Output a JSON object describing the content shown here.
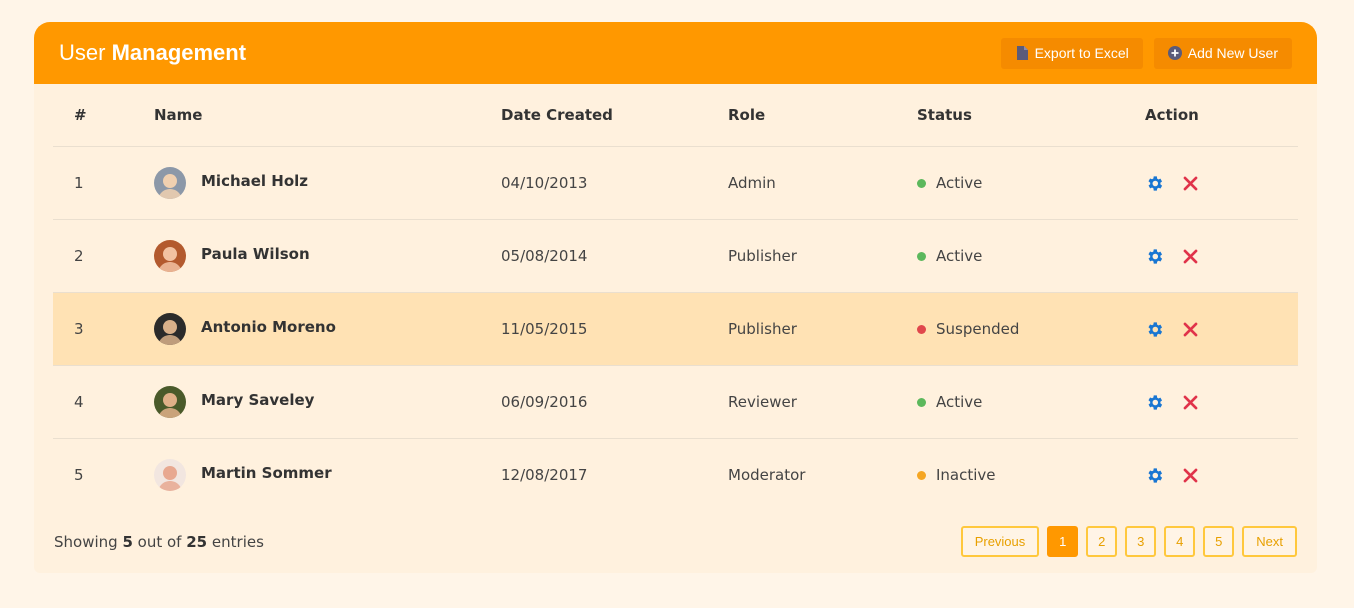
{
  "header": {
    "title_part1": "User",
    "title_part2": "Management",
    "export_label": "Export to Excel",
    "add_label": "Add New User"
  },
  "table": {
    "columns": [
      "#",
      "Name",
      "Date Created",
      "Role",
      "Status",
      "Action"
    ],
    "rows": [
      {
        "num": "1",
        "name": "Michael Holz",
        "date": "04/10/2013",
        "role": "Admin",
        "status": "Active",
        "status_color": "#5cb85c",
        "avatar_bg": "#8c98a8",
        "avatar_fg": "#f0d0b0"
      },
      {
        "num": "2",
        "name": "Paula Wilson",
        "date": "05/08/2014",
        "role": "Publisher",
        "status": "Active",
        "status_color": "#5cb85c",
        "avatar_bg": "#b35a2e",
        "avatar_fg": "#f2c2a2"
      },
      {
        "num": "3",
        "name": "Antonio Moreno",
        "date": "11/05/2015",
        "role": "Publisher",
        "status": "Suspended",
        "status_color": "#e0474c",
        "avatar_bg": "#2b2b2b",
        "avatar_fg": "#d9b08a"
      },
      {
        "num": "4",
        "name": "Mary Saveley",
        "date": "06/09/2016",
        "role": "Reviewer",
        "status": "Active",
        "status_color": "#5cb85c",
        "avatar_bg": "#4a5a2a",
        "avatar_fg": "#e0b088"
      },
      {
        "num": "5",
        "name": "Martin Sommer",
        "date": "12/08/2017",
        "role": "Moderator",
        "status": "Inactive",
        "status_color": "#f5a623",
        "avatar_bg": "#f2e6e0",
        "avatar_fg": "#e8a890"
      }
    ],
    "highlight_row": 3
  },
  "footer": {
    "showing_pre": "Showing",
    "shown": "5",
    "out_of": "out of",
    "total": "25",
    "entries": "entries"
  },
  "pagination": {
    "previous": "Previous",
    "pages": [
      "1",
      "2",
      "3",
      "4",
      "5"
    ],
    "active": "1",
    "next": "Next"
  },
  "colors": {
    "accent": "#ff9800",
    "settings_icon": "#1976d2",
    "delete_icon": "#e0334a"
  },
  "icons": {
    "export": "file-icon",
    "add": "plus-circle-icon",
    "settings": "gear-icon",
    "delete": "close-icon"
  }
}
